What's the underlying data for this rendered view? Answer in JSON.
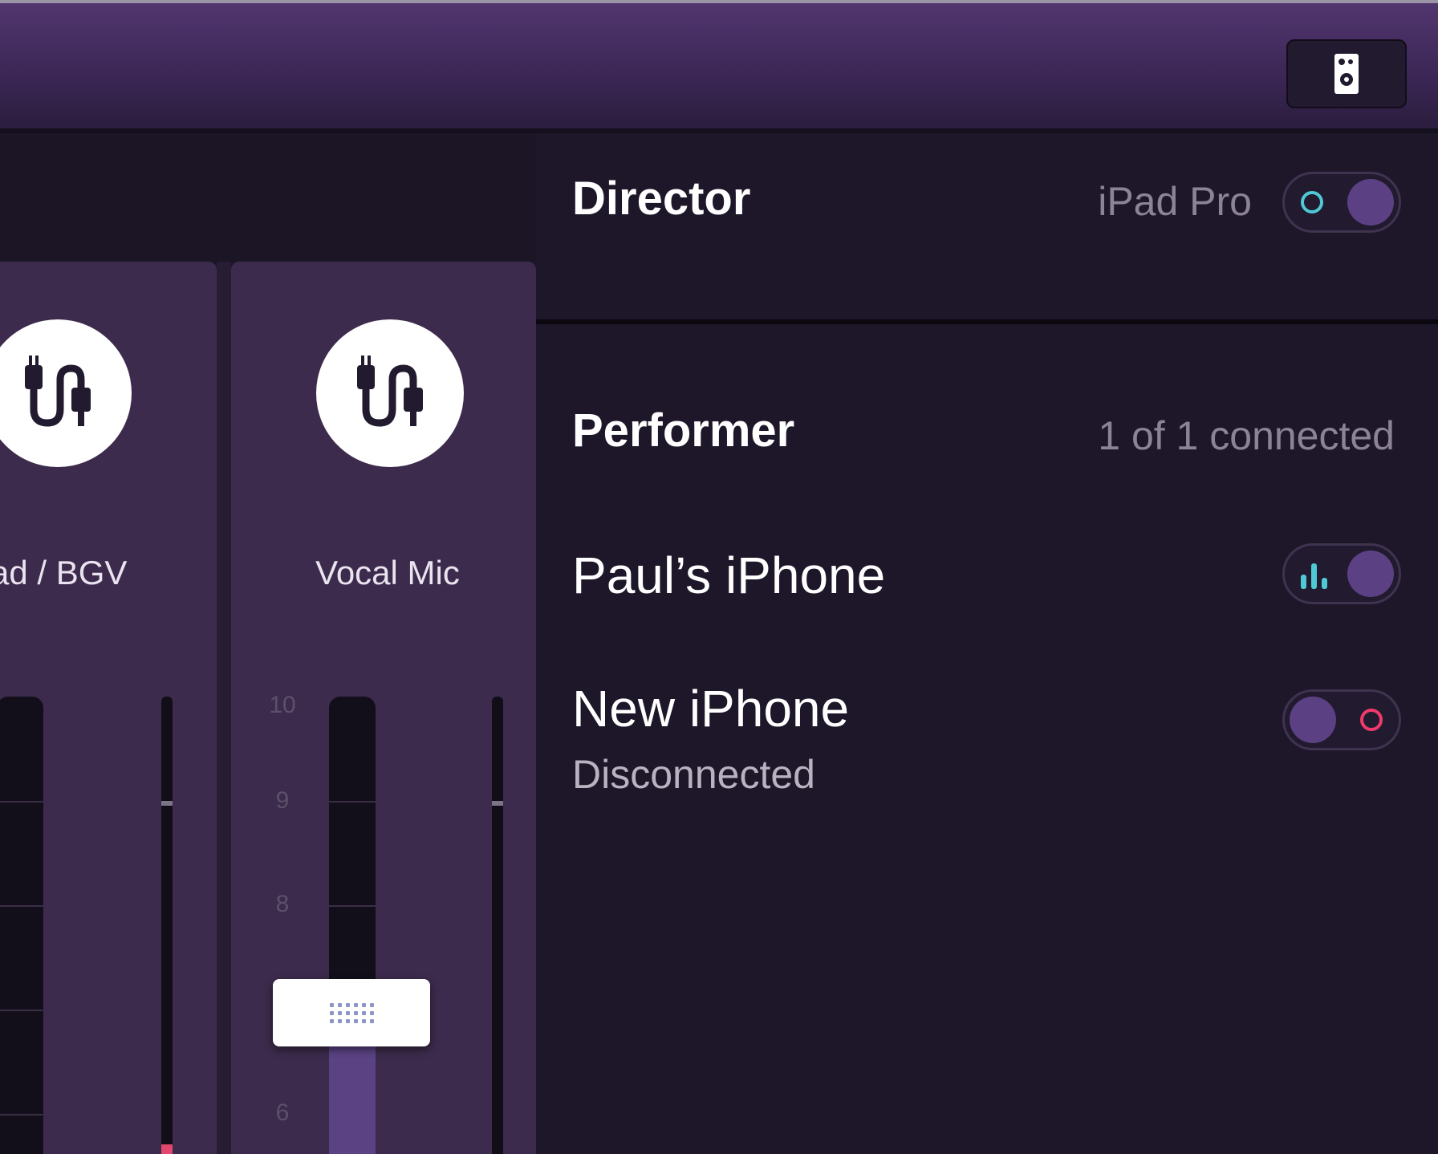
{
  "header": {
    "speaker_icon": "speaker-icon"
  },
  "mixer": {
    "strips": [
      {
        "label": "ad / BGV",
        "icon": "plug-icon"
      },
      {
        "label": "Vocal Mic",
        "icon": "plug-icon"
      }
    ],
    "scale": [
      "10",
      "9",
      "8",
      "6"
    ],
    "fader_icon": "grip-icon"
  },
  "director": {
    "title": "Director",
    "device": "iPad Pro",
    "toggle_on": true
  },
  "performer": {
    "title": "Performer",
    "count": "1 of 1 connected",
    "devices": [
      {
        "name": "Paul’s iPhone",
        "status": "",
        "state": "connected",
        "icon": "level-bars-icon"
      },
      {
        "name": "New iPhone",
        "status": "Disconnected",
        "state": "disconnected",
        "icon": "ring-icon"
      }
    ]
  },
  "colors": {
    "accent_purple": "#5b4184",
    "connected_teal": "#4fc9d6",
    "disconnected_pink": "#f03a6e",
    "panel_bg": "#1e1629"
  }
}
